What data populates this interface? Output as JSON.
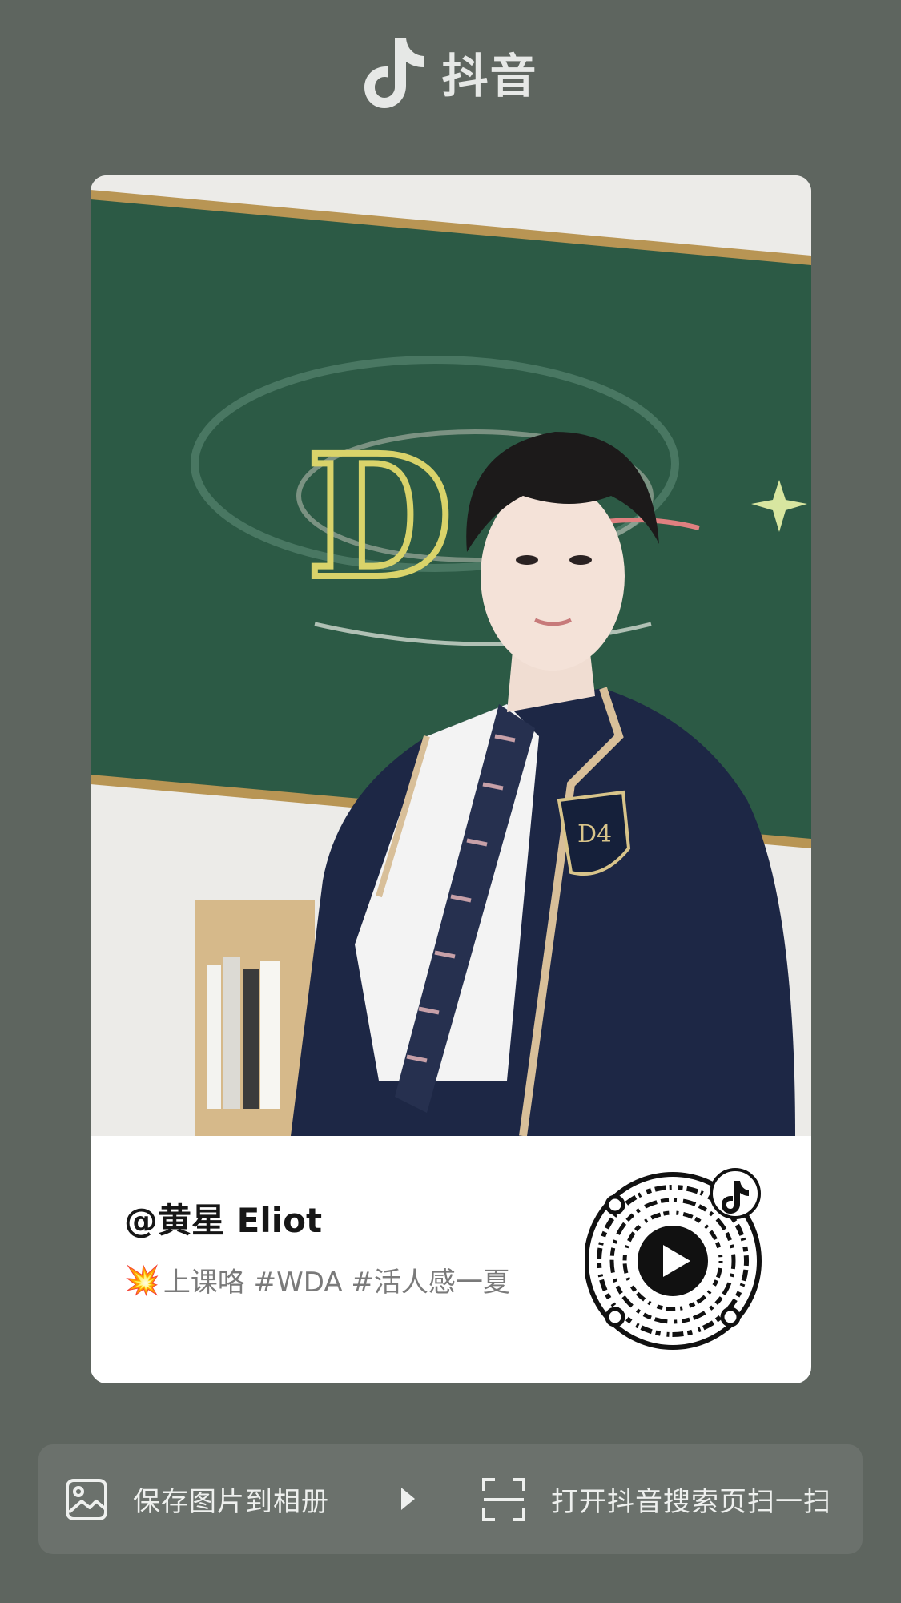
{
  "brand": {
    "name": "抖音",
    "icon": "douyin-note-icon"
  },
  "card": {
    "author": "@黄星 Eliot",
    "caption_emoji": "💥",
    "caption": "上课咯 #WDA #活人感一夏"
  },
  "actions": {
    "save_label": "保存图片到相册",
    "save_icon": "image-icon",
    "scan_label": "打开抖音搜索页扫一扫",
    "scan_icon": "scan-icon"
  },
  "colors": {
    "background": "#5e655f",
    "action_bar": "#6b716c",
    "card": "#ffffff"
  }
}
